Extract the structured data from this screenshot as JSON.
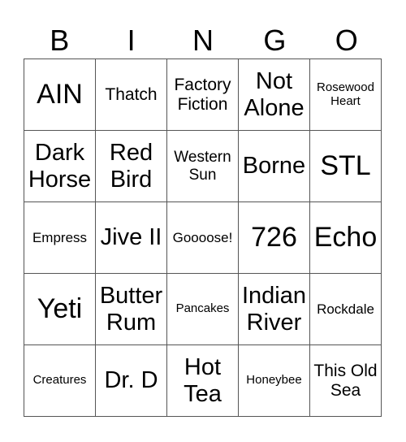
{
  "header": [
    "B",
    "I",
    "N",
    "G",
    "O"
  ],
  "cells": [
    {
      "text": "AIN",
      "size": "xl"
    },
    {
      "text": "Thatch",
      "size": "m"
    },
    {
      "text": "Factory Fiction",
      "size": "m"
    },
    {
      "text": "Not Alone",
      "size": "l"
    },
    {
      "text": "Rosewood Heart",
      "size": "xs"
    },
    {
      "text": "Dark Horse",
      "size": "l"
    },
    {
      "text": "Red Bird",
      "size": "l"
    },
    {
      "text": "Western Sun",
      "size": "sm"
    },
    {
      "text": "Borne",
      "size": "l"
    },
    {
      "text": "STL",
      "size": "xl"
    },
    {
      "text": "Empress",
      "size": "s"
    },
    {
      "text": "Jive II",
      "size": "l"
    },
    {
      "text": "Goooose!",
      "size": "s"
    },
    {
      "text": "726",
      "size": "xl"
    },
    {
      "text": "Echo",
      "size": "xl"
    },
    {
      "text": "Yeti",
      "size": "xl"
    },
    {
      "text": "Butter Rum",
      "size": "l"
    },
    {
      "text": "Pancakes",
      "size": "xs"
    },
    {
      "text": "Indian River",
      "size": "l"
    },
    {
      "text": "Rockdale",
      "size": "s"
    },
    {
      "text": "Creatures",
      "size": "xs"
    },
    {
      "text": "Dr. D",
      "size": "l"
    },
    {
      "text": "Hot Tea",
      "size": "l"
    },
    {
      "text": "Honeybee",
      "size": "xs"
    },
    {
      "text": "This Old Sea",
      "size": "m"
    }
  ]
}
